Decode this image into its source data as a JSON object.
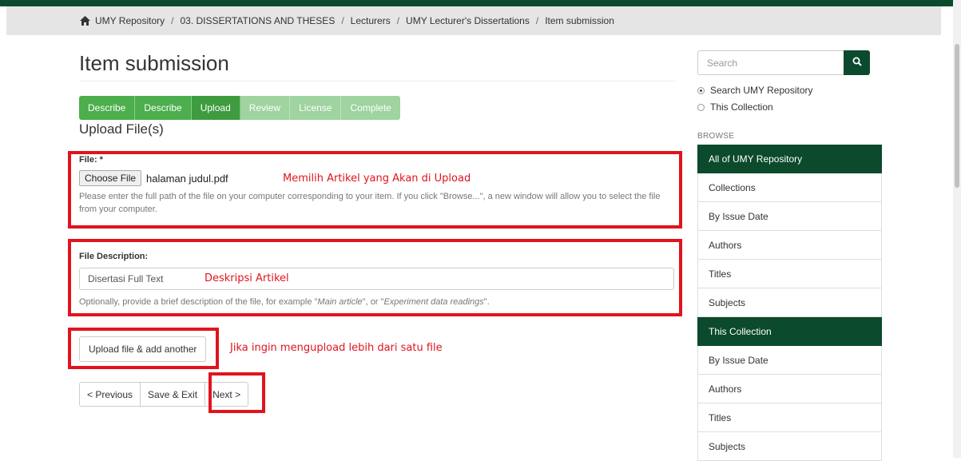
{
  "breadcrumb": {
    "home_icon": "home-icon",
    "items": [
      "UMY Repository",
      "03. DISSERTATIONS AND THESES",
      "Lecturers",
      "UMY Lecturer's Dissertations",
      "Item submission"
    ],
    "separator": "/"
  },
  "page": {
    "title": "Item submission",
    "section_title": "Upload File(s)"
  },
  "steps": [
    {
      "label": "Describe",
      "state": "done"
    },
    {
      "label": "Describe",
      "state": "done"
    },
    {
      "label": "Upload",
      "state": "current"
    },
    {
      "label": "Review",
      "state": "todo"
    },
    {
      "label": "License",
      "state": "todo"
    },
    {
      "label": "Complete",
      "state": "todo"
    }
  ],
  "file_field": {
    "label": "File: *",
    "choose_button": "Choose File",
    "file_name": "halaman judul.pdf",
    "help": "Please enter the full path of the file on your computer corresponding to your item. If you click \"Browse...\", a new window will allow you to select the file from your computer."
  },
  "description_field": {
    "label": "File Description:",
    "value": "Disertasi Full Text",
    "help_prefix": "Optionally, provide a brief description of the file, for example \"",
    "help_em1": "Main article",
    "help_mid": "\", or \"",
    "help_em2": "Experiment data readings",
    "help_suffix": "\"."
  },
  "buttons": {
    "upload_another": "Upload file & add another",
    "previous": "< Previous",
    "save_exit": "Save & Exit",
    "next": "Next >"
  },
  "annotations": {
    "file": "Memilih Artikel yang Akan di Upload",
    "description": "Deskripsi Artikel",
    "upload_another": "Jika ingin mengupload lebih dari satu file"
  },
  "sidebar": {
    "search_placeholder": "Search",
    "search_icon": "search-icon",
    "scope_options": [
      {
        "label": "Search UMY Repository",
        "checked": true
      },
      {
        "label": "This Collection",
        "checked": false
      }
    ],
    "browse_label": "BROWSE",
    "group1_header": "All of UMY Repository",
    "group1_items": [
      "Collections",
      "By Issue Date",
      "Authors",
      "Titles",
      "Subjects"
    ],
    "group2_header": "This Collection",
    "group2_items": [
      "By Issue Date",
      "Authors",
      "Titles",
      "Subjects"
    ]
  },
  "colors": {
    "brand_green": "#0b4a2c",
    "step_done": "#4cae4c",
    "step_current": "#3e9c3e",
    "step_todo": "#9fd39f",
    "annotation_red": "#e0141e"
  }
}
